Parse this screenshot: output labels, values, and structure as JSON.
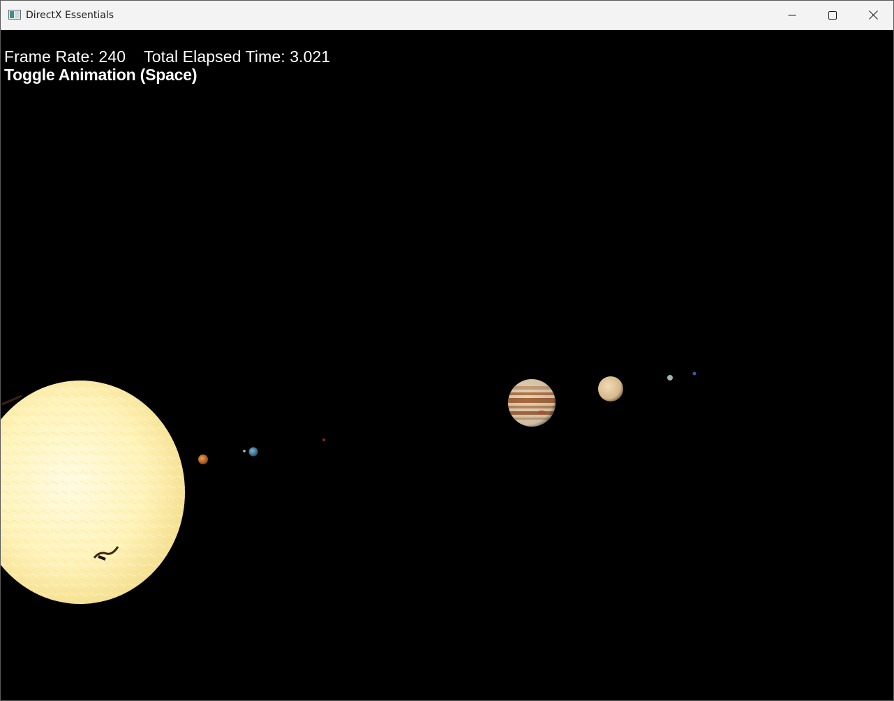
{
  "window": {
    "title": "DirectX Essentials",
    "icon": "app-window-icon",
    "controls": {
      "minimize_icon": "minimize-icon",
      "maximize_icon": "maximize-icon",
      "close_icon": "close-icon"
    }
  },
  "hud": {
    "frame_rate_label": "Frame Rate:",
    "frame_rate_value": "240",
    "elapsed_label": "Total Elapsed Time:",
    "elapsed_value": "3.021",
    "toggle_hint": "Toggle Animation (Space)"
  },
  "scene": {
    "background_color": "#000000",
    "bodies": [
      "sun",
      "mercury",
      "venus",
      "earth",
      "mars",
      "jupiter",
      "saturn",
      "uranus",
      "neptune"
    ]
  }
}
